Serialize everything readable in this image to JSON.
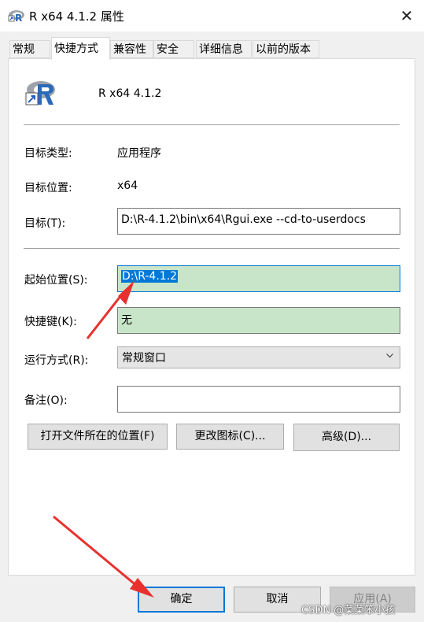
{
  "window": {
    "title": "R x64 4.1.2 属性",
    "close_glyph": "✕"
  },
  "tabs": [
    {
      "label": "常规"
    },
    {
      "label": "快捷方式"
    },
    {
      "label": "兼容性"
    },
    {
      "label": "安全"
    },
    {
      "label": "详细信息"
    },
    {
      "label": "以前的版本"
    }
  ],
  "app": {
    "name": "R x64 4.1.2",
    "icon": "r-logo-icon"
  },
  "fields": {
    "target_type": {
      "label": "目标类型:",
      "value": "应用程序"
    },
    "target_location": {
      "label": "目标位置:",
      "value": "x64"
    },
    "target": {
      "label": "目标(T):",
      "value": "D:\\R-4.1.2\\bin\\x64\\Rgui.exe --cd-to-userdocs"
    },
    "start_in": {
      "label": "起始位置(S):",
      "value": "D:\\R-4.1.2"
    },
    "shortcut_key": {
      "label": "快捷键(K):",
      "value": "无"
    },
    "run": {
      "label": "运行方式(R):",
      "value": "常规窗口"
    },
    "comment": {
      "label": "备注(O):",
      "value": ""
    }
  },
  "buttons": {
    "open_location": "打开文件所在的位置(F)",
    "change_icon": "更改图标(C)...",
    "advanced": "高级(D)...",
    "ok": "确定",
    "cancel": "取消",
    "apply": "应用(A)"
  },
  "watermark": "CSDN @菜菜笨小孩",
  "colors": {
    "accent": "#0078d7",
    "highlight_green": "#c9e5c9",
    "arrow_red": "#e8312e"
  }
}
